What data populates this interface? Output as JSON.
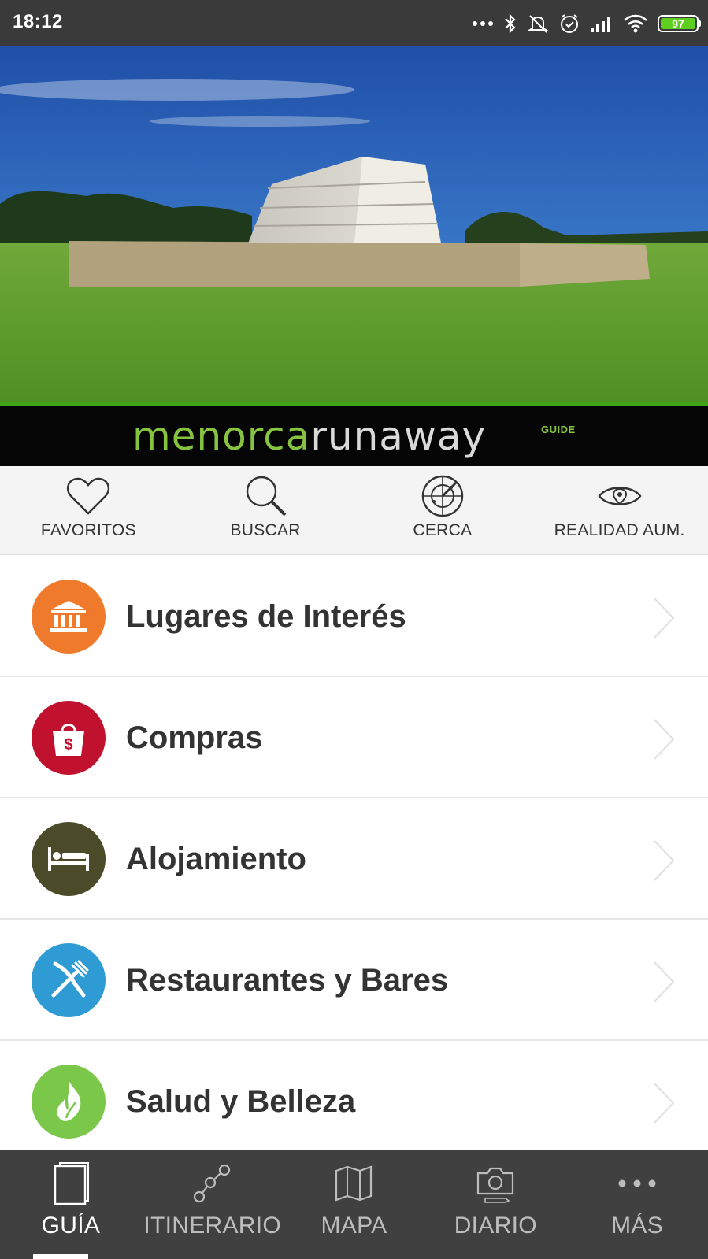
{
  "status_bar": {
    "time": "18:12",
    "battery_level": "97",
    "icons": [
      "dots-icon",
      "bluetooth-icon",
      "silent-icon",
      "alarm-icon",
      "signal-icon",
      "wifi-icon",
      "battery-icon"
    ]
  },
  "brand": {
    "part_a": "menorca",
    "part_b": "runaway",
    "suffix": "GUIDE"
  },
  "quick_actions": [
    {
      "label": "FAVORITOS",
      "icon": "heart-icon"
    },
    {
      "label": "BUSCAR",
      "icon": "search-icon"
    },
    {
      "label": "CERCA",
      "icon": "radar-icon"
    },
    {
      "label": "REALIDAD AUM.",
      "icon": "eye-location-icon"
    }
  ],
  "categories": [
    {
      "label": "Lugares de Interés",
      "icon": "monument-icon",
      "color": "#f07a2c"
    },
    {
      "label": "Compras",
      "icon": "shopping-bag-icon",
      "color": "#c0122e"
    },
    {
      "label": "Alojamiento",
      "icon": "bed-icon",
      "color": "#4b4a29"
    },
    {
      "label": "Restaurantes y Bares",
      "icon": "fork-knife-icon",
      "color": "#2f9bd4"
    },
    {
      "label": "Salud y Belleza",
      "icon": "flame-leaf-icon",
      "color": "#7bc74a"
    }
  ],
  "bottom_nav": [
    {
      "label": "GUÍA",
      "icon": "book-icon",
      "active": true
    },
    {
      "label": "ITINERARIO",
      "icon": "route-icon",
      "active": false
    },
    {
      "label": "MAPA",
      "icon": "map-icon",
      "active": false
    },
    {
      "label": "DIARIO",
      "icon": "camera-icon",
      "active": false
    },
    {
      "label": "MÁS",
      "icon": "more-icon",
      "active": false
    }
  ],
  "colors": {
    "brand_green": "#86c440",
    "status_bar": "#3a3a3a",
    "bottom_nav": "#404040"
  }
}
